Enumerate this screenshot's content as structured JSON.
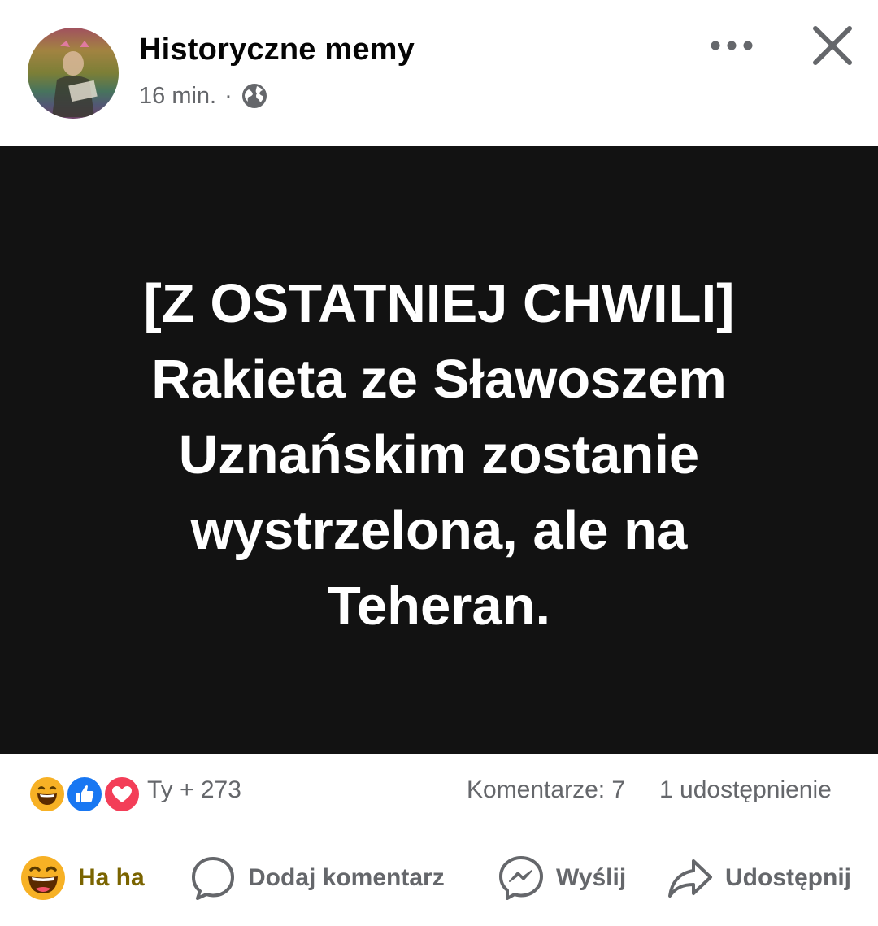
{
  "header": {
    "author_name": "Historyczne memy",
    "time_ago": "16 min.",
    "separator": "·",
    "visibility_icon": "globe-icon",
    "more_icon": "more-options-icon",
    "close_icon": "close-icon"
  },
  "post": {
    "background_color": "#121212",
    "text_color": "#ffffff",
    "lines": [
      "[Z OSTATNIEJ CHWILI]",
      "Rakieta ze Sławoszem",
      "Uznańskim zostanie",
      "wystrzelona, ale na",
      "Teheran."
    ]
  },
  "reactions": {
    "icons": [
      "haha-icon",
      "like-icon",
      "love-icon"
    ],
    "summary": "Ty + 273",
    "comments": "Komentarze: 7",
    "shares": "1 udostępnienie",
    "colors": {
      "like": "#1877f2",
      "love": "#f33e58",
      "haha": "#f7b125"
    }
  },
  "actions": {
    "haha_label": "Ha ha",
    "comment_label": "Dodaj komentarz",
    "send_label": "Wyślij",
    "share_label": "Udostępnij"
  }
}
